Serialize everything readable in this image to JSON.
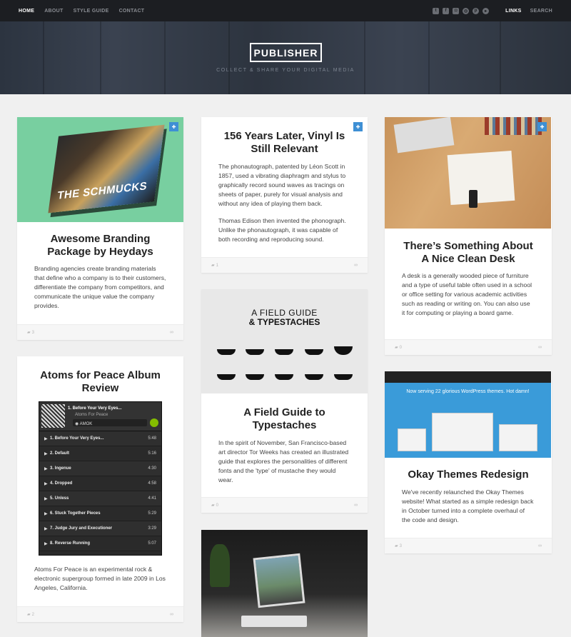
{
  "nav": {
    "links": [
      "HOME",
      "ABOUT",
      "STYLE GUIDE",
      "CONTACT"
    ],
    "right_links": [
      "LINKS",
      "SEARCH"
    ],
    "social_icons": [
      "twitter-icon",
      "facebook-icon",
      "instagram-icon",
      "dribbble-icon",
      "pinterest-icon",
      "vimeo-icon"
    ]
  },
  "hero": {
    "logo": "PUBLISHER",
    "tagline": "COLLECT & SHARE YOUR DIGITAL MEDIA"
  },
  "cards": {
    "branding": {
      "book_title": "THE SCHMUCKS",
      "title": "Awesome Branding Package by Heydays",
      "text": "Branding agencies create branding materials that define who a company is to their customers, differentiate the company from competitors, and communicate the unique value the company provides.",
      "comments": "3"
    },
    "atoms": {
      "title": "Atoms for Peace Album Review",
      "player": {
        "now_playing": "1. Before Your Very Eyes...",
        "artist": "Atoms For Peace",
        "album": "AMOK",
        "tracks": [
          {
            "name": "1. Before Your Very Eyes...",
            "duration": "5:48"
          },
          {
            "name": "2. Default",
            "duration": "5:16"
          },
          {
            "name": "3. Ingenue",
            "duration": "4:30"
          },
          {
            "name": "4. Dropped",
            "duration": "4:58"
          },
          {
            "name": "5. Unless",
            "duration": "4:41"
          },
          {
            "name": "6. Stuck Together Pieces",
            "duration": "5:29"
          },
          {
            "name": "7. Judge Jury and Executioner",
            "duration": "3:29"
          },
          {
            "name": "8. Reverse Running",
            "duration": "5:07"
          }
        ]
      },
      "text": "Atoms For Peace is an experimental rock & electronic supergroup formed in late 2009 in Los Angeles, California.",
      "comments": "2"
    },
    "vinyl": {
      "title": "156 Years Later, Vinyl Is Still Relevant",
      "text1": "The phonautograph, patented by Léon Scott in 1857, used a vibrating diaphragm and stylus to graphically record sound waves as tracings on sheets of paper, purely for visual analysis and without any idea of playing them back.",
      "text2": "Thomas Edison then invented the phonograph. Unlike the phonautograph, it was capable of both recording and reproducing sound.",
      "comments": "1"
    },
    "fieldguide": {
      "image_title1": "A FIELD GUIDE",
      "image_title2": "TYPESTACHES",
      "title": "A Field Guide to Typestaches",
      "text": "In the spirit of November, San Francisco-based art director Tor Weeks has created an illustrated guide that explores the personalities of different fonts and the 'type' of mustache they would wear.",
      "comments": "0"
    },
    "desk": {
      "title": "There’s Something About A Nice Clean Desk",
      "text": "A desk is a generally wooded piece of furniture and a type of useful table often used in a school or office setting for various academic activities such as reading or writing on. You can also use it for computing or playing a board game.",
      "comments": "0"
    },
    "okay": {
      "image_heading": "Now serving 22 glorious WordPress themes. Hot damn!",
      "title": "Okay Themes Redesign",
      "text": "We've recently relaunched the Okay Themes website! What started as a simple redesign back in October turned into a complete overhaul of the code and design.",
      "comments": "3"
    }
  },
  "colors": {
    "nav_bg": "#1c1e22",
    "pin_blue": "#3e8fd4",
    "page_bg": "#f0f0f0"
  }
}
